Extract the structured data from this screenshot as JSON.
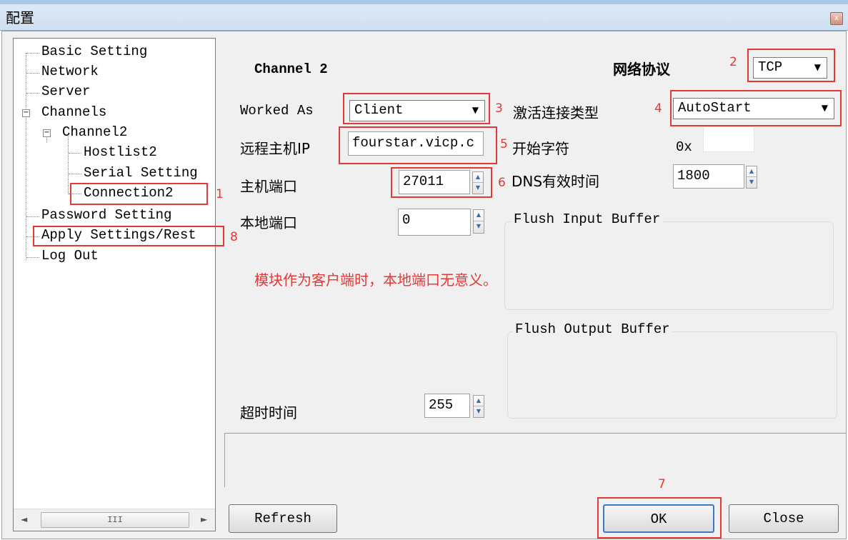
{
  "window": {
    "title": "配置",
    "close_glyph": "x"
  },
  "tree": {
    "items": [
      {
        "label": "Basic Setting"
      },
      {
        "label": "Network"
      },
      {
        "label": "Server"
      },
      {
        "label": "Channels",
        "expander": "−"
      },
      {
        "label": "Channel2",
        "expander": "−"
      },
      {
        "label": "Hostlist2"
      },
      {
        "label": "Serial Setting"
      },
      {
        "label": "Connection2"
      },
      {
        "label": "Password Setting"
      },
      {
        "label": "Apply Settings/Rest"
      },
      {
        "label": "Log Out"
      }
    ],
    "scroll": {
      "left_arrow": "◄",
      "right_arrow": "►",
      "thumb_grip": "III"
    }
  },
  "form": {
    "channel_title": "Channel 2",
    "protocol_label": "网络协议",
    "protocol_value": "TCP",
    "worked_as_label": "Worked As",
    "worked_as_value": "Client",
    "activate_label": "激活连接类型",
    "activate_value": "AutoStart",
    "remote_ip_label": "远程主机IP",
    "remote_ip_value": "fourstar.vicp.c",
    "start_char_label": "开始字符",
    "start_char_prefix": "0x",
    "start_char_value": "",
    "host_port_label": "主机端口",
    "host_port_value": "27011",
    "dns_label": "DNS有效时间",
    "dns_value": "1800",
    "local_port_label": "本地端口",
    "local_port_value": "0",
    "flush_input_label": "Flush Input Buffer",
    "flush_output_label": "Flush Output Buffer",
    "note": "模块作为客户端时，本地端口无意义。",
    "timeout_label": "超时时间",
    "timeout_value": "255",
    "caret_glyph": "▼",
    "spin_up": "▲",
    "spin_down": "▼"
  },
  "buttons": {
    "refresh": "Refresh",
    "ok": "OK",
    "close": "Close"
  },
  "annotations": {
    "n1": "1",
    "n2": "2",
    "n3": "3",
    "n4": "4",
    "n5": "5",
    "n6": "6",
    "n7": "7",
    "n8": "8"
  },
  "colors": {
    "annotation_red": "#e53935",
    "title_bar": "#cfe0f1",
    "dialog_bg": "#f0f0f0"
  }
}
